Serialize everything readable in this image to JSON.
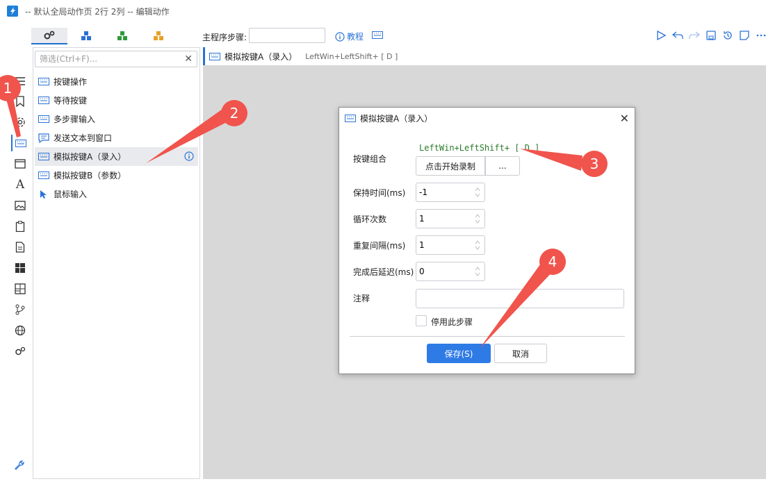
{
  "window": {
    "title": "-- 默认全局动作页 2行 2列 -- 编辑动作"
  },
  "topbar": {
    "main_step_label": "主程序步骤:",
    "main_step_value": "",
    "tutorial_label": "教程"
  },
  "filter": {
    "placeholder": "筛选(Ctrl+F)..."
  },
  "actions": {
    "items": [
      {
        "label": "按键操作",
        "icon": "keyboard-icon"
      },
      {
        "label": "等待按键",
        "icon": "keyboard-icon"
      },
      {
        "label": "多步骤输入",
        "icon": "keyboard-icon"
      },
      {
        "label": "发送文本到窗口",
        "icon": "message-icon"
      },
      {
        "label": "模拟按键A（录入）",
        "icon": "keyboard-icon",
        "selected": true
      },
      {
        "label": "模拟按键B（参数）",
        "icon": "keyboard-icon"
      },
      {
        "label": "鼠标输入",
        "icon": "cursor-icon"
      }
    ]
  },
  "content_header": {
    "name": "模拟按键A（录入）",
    "keys": "LeftWin+LeftShift+ [ D ]"
  },
  "dialog": {
    "title": "模拟按键A（录入）",
    "key_combo_label": "按键组合",
    "key_combo_value": "LeftWin+LeftShift+ [ D ]",
    "record_button": "点击开始录制",
    "more_button": "...",
    "hold_time_label": "保持时间(ms)",
    "hold_time_value": "-1",
    "loop_count_label": "循环次数",
    "loop_count_value": "1",
    "repeat_interval_label": "重复间隔(ms)",
    "repeat_interval_value": "1",
    "post_delay_label": "完成后延迟(ms)",
    "post_delay_value": "0",
    "note_label": "注释",
    "note_value": "",
    "disable_step_label": "停用此步骤",
    "save_button": "保存(S)",
    "cancel_button": "取消"
  },
  "markers": [
    "1",
    "2",
    "3",
    "4"
  ],
  "colors": {
    "accent": "#2f7be6",
    "marker": "#f0544c",
    "key_combo": "#2b7a2b"
  }
}
